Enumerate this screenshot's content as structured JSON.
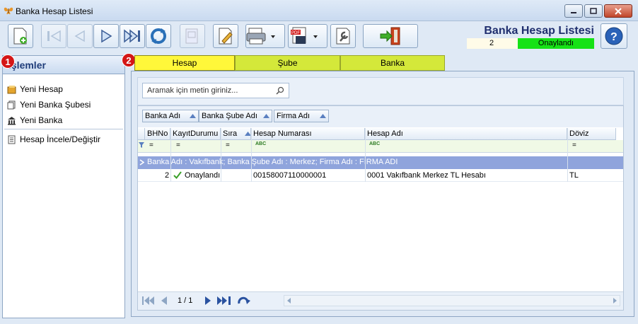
{
  "window": {
    "title": "Banka Hesap Listesi",
    "buttons": [
      "minimize",
      "maximize",
      "close"
    ]
  },
  "toolbar": {
    "buttons": [
      {
        "name": "new-icon",
        "enabled": true
      },
      {
        "name": "first-icon",
        "enabled": false
      },
      {
        "name": "prev-icon",
        "enabled": false
      },
      {
        "name": "next-icon",
        "enabled": true
      },
      {
        "name": "last-icon",
        "enabled": true
      },
      {
        "name": "refresh-icon",
        "enabled": true
      },
      {
        "name": "preview-icon",
        "enabled": false
      },
      {
        "name": "edit-icon",
        "enabled": true
      },
      {
        "name": "print-icon",
        "enabled": true
      },
      {
        "name": "pdf-export-icon",
        "enabled": true
      },
      {
        "name": "settings-icon",
        "enabled": true
      },
      {
        "name": "exit-icon",
        "enabled": true
      }
    ]
  },
  "header": {
    "title": "Banka Hesap Listesi",
    "record_no": "2",
    "status": "Onaylandı",
    "status_color": "#16e216"
  },
  "sidebar": {
    "title": "İşlemler",
    "items": [
      {
        "label": "Yeni Hesap",
        "icon": "folder-icon"
      },
      {
        "label": "Yeni Banka Şubesi",
        "icon": "document-icon"
      },
      {
        "label": "Yeni Banka",
        "icon": "bank-icon"
      },
      {
        "label": "Hesap İncele/Değiştir",
        "icon": "list-icon"
      }
    ]
  },
  "badges": {
    "one": "1",
    "two": "2"
  },
  "tabs": [
    {
      "label": "Hesap",
      "active": true
    },
    {
      "label": "Şube",
      "active": false
    },
    {
      "label": "Banka",
      "active": false
    }
  ],
  "search": {
    "placeholder": "Aramak için metin giriniz..."
  },
  "grid": {
    "group_by": [
      "Banka Adı",
      "Banka Şube Adı",
      "Firma Adı"
    ],
    "columns": [
      "BHNo",
      "KayıtDurumu",
      "Sıra",
      "Hesap Numarası",
      "Hesap Adı",
      "Döviz"
    ],
    "filter_symbols": [
      "=",
      "=",
      "=",
      "ABC",
      "ABC",
      "="
    ],
    "group_row": "Banka Adı : Vakıfbank; Banka Şube Adı : Merkez; Firma Adı : FİRMA ADI",
    "rows": [
      {
        "bhno": "2",
        "status": "Onaylandı",
        "sira": "",
        "hesap_no": "00158007110000001",
        "hesap_adi": "0001 Vakıfbank Merkez TL Hesabı",
        "doviz": "TL"
      }
    ],
    "page": "1 / 1"
  }
}
